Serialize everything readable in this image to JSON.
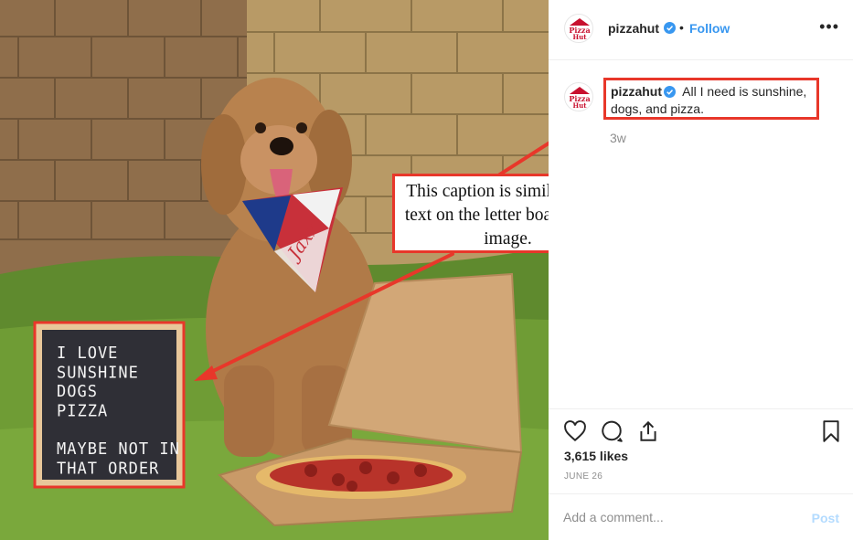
{
  "post": {
    "username": "pizzahut",
    "follow_label": "Follow",
    "separator": "•",
    "more_label": "•••",
    "caption": "All I need is sunshine, dogs, and pizza.",
    "time_ago": "3w",
    "likes": "3,615 likes",
    "date": "JUNE 26",
    "comment_placeholder": "Add a comment...",
    "post_label": "Post"
  },
  "logo": {
    "line1": "Pizza",
    "line2": "Hut"
  },
  "photo": {
    "letterboard_text": "I LOVE\nSUNSHINE\nDOGS\nPIZZA\n\nMAYBE NOT IN\nTHAT ORDER",
    "bandana_text": "Jaxx"
  },
  "annotation": {
    "callout_text": "This caption is similar to the text on the letter board in the image."
  },
  "icons": {
    "verified": "verified-badge-icon",
    "like": "heart-icon",
    "comment": "comment-bubble-icon",
    "share": "share-icon",
    "save": "bookmark-icon",
    "more": "ellipsis-icon"
  },
  "colors": {
    "highlight": "#e8372a",
    "link": "#3897f0",
    "post_disabled": "#b3dbff",
    "brand_red": "#c8102e"
  }
}
